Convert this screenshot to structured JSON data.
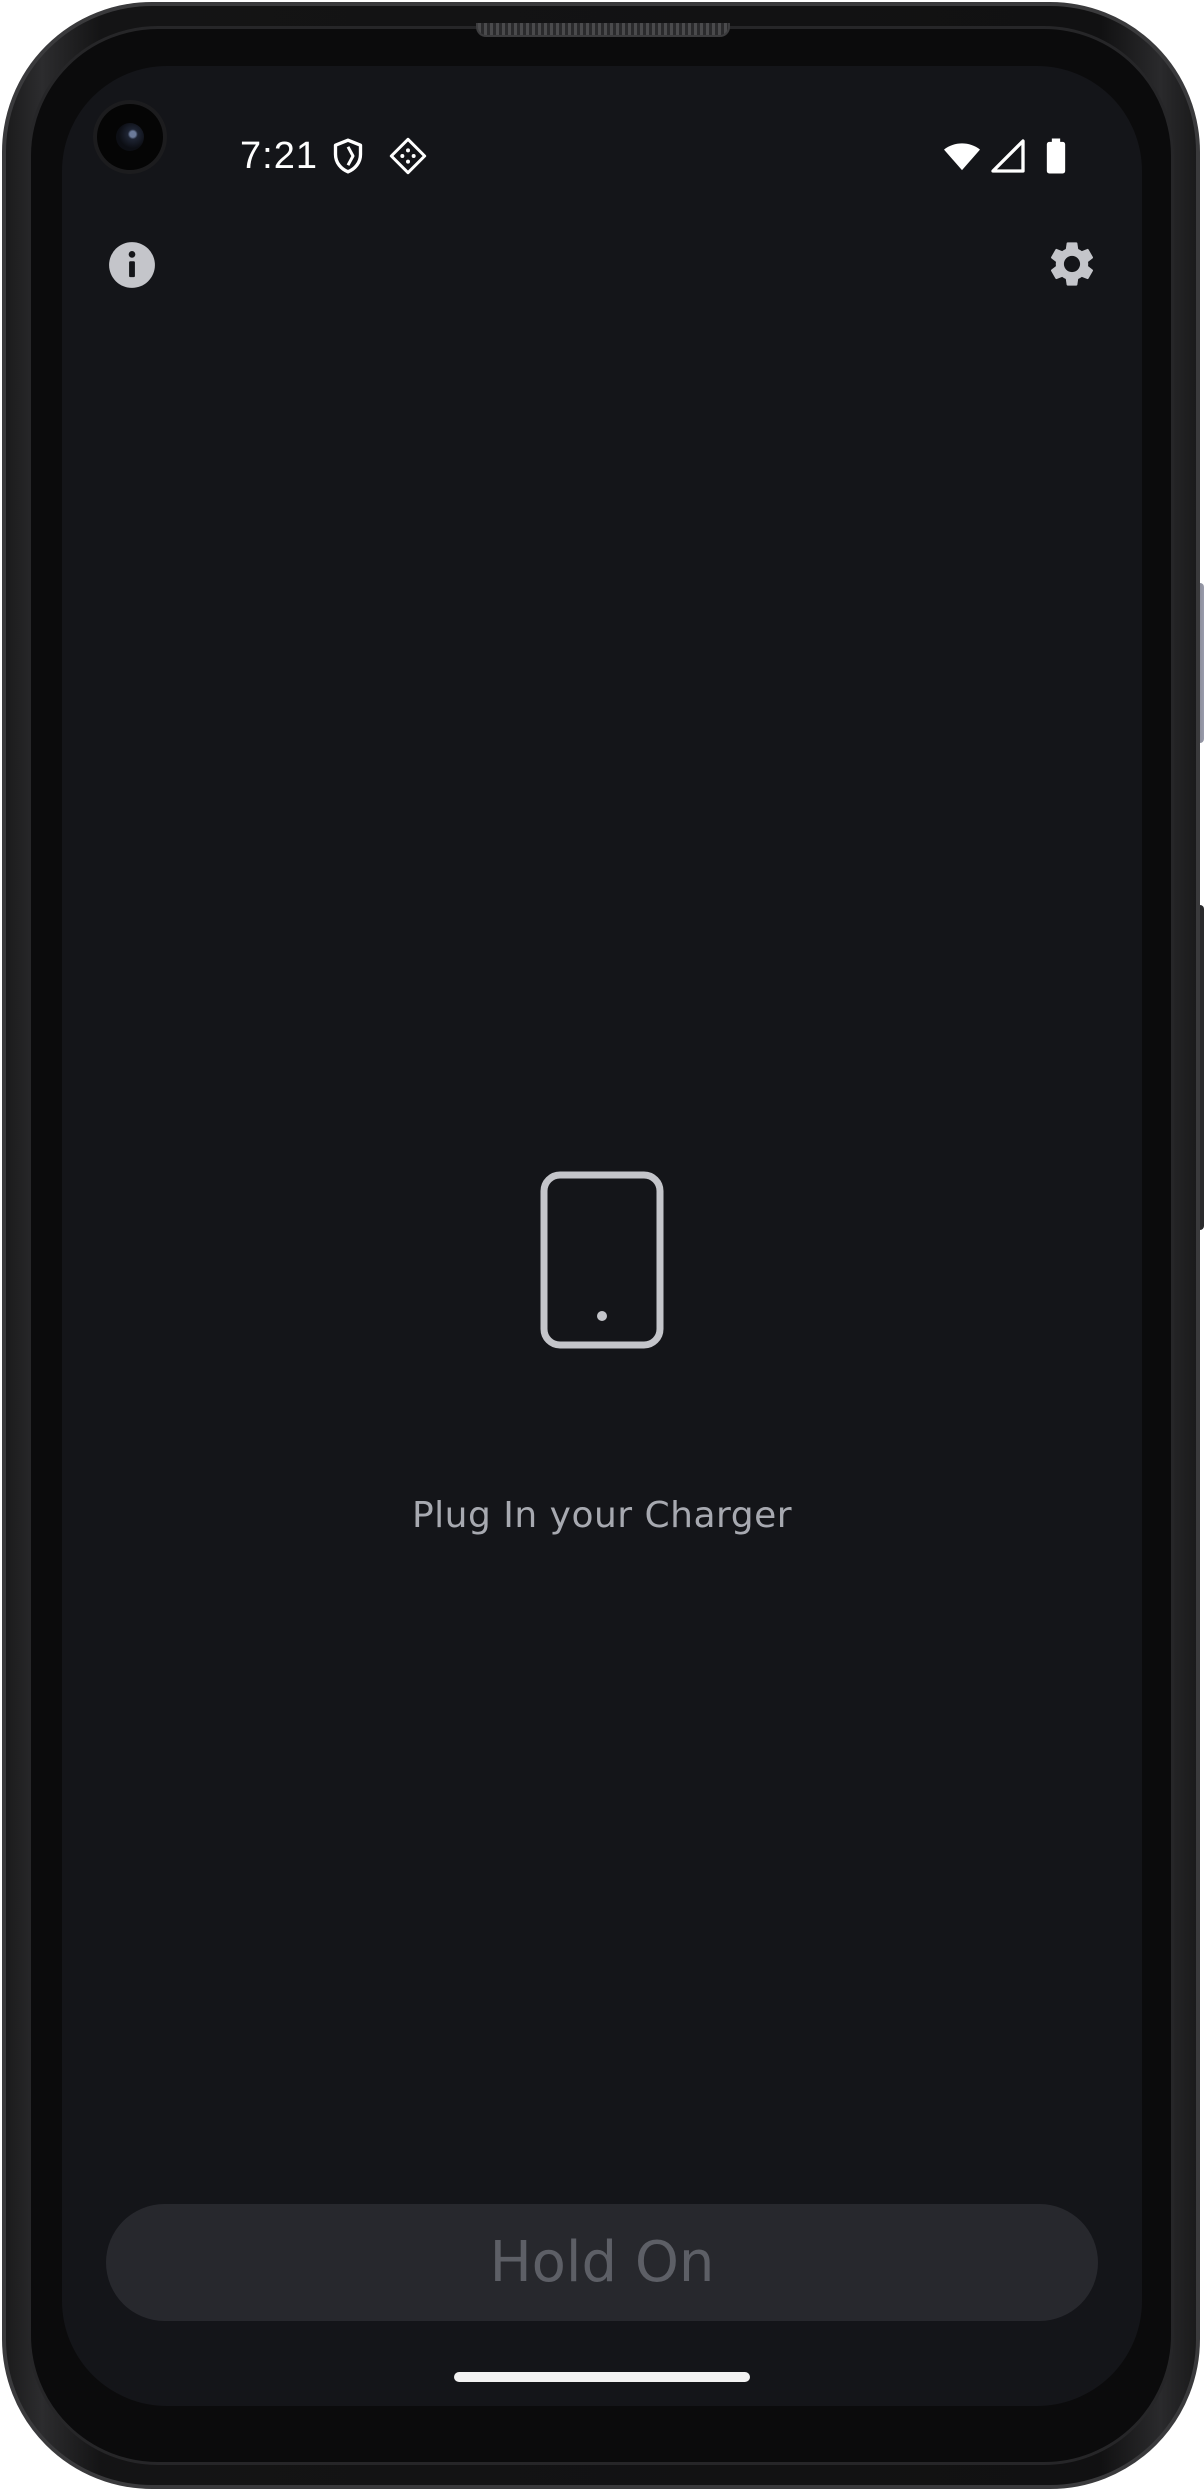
{
  "status_bar": {
    "time": "7:21",
    "left_icons": [
      "shield-icon",
      "game-controller-icon"
    ],
    "right_icons": [
      "wifi-icon",
      "cellular-signal-icon",
      "battery-icon"
    ]
  },
  "app_bar": {
    "left_icon": "info-icon",
    "right_icon": "gear-icon"
  },
  "main": {
    "illustration_icon": "smartphone-icon",
    "message": "Plug In your Charger"
  },
  "footer": {
    "button_label": "Hold On"
  },
  "colors": {
    "screen_background": "#141519",
    "message_text": "#a7a9b0",
    "button_background": "#27282d",
    "button_text": "#5d5f66",
    "icon_gray": "#c4c5ca"
  }
}
